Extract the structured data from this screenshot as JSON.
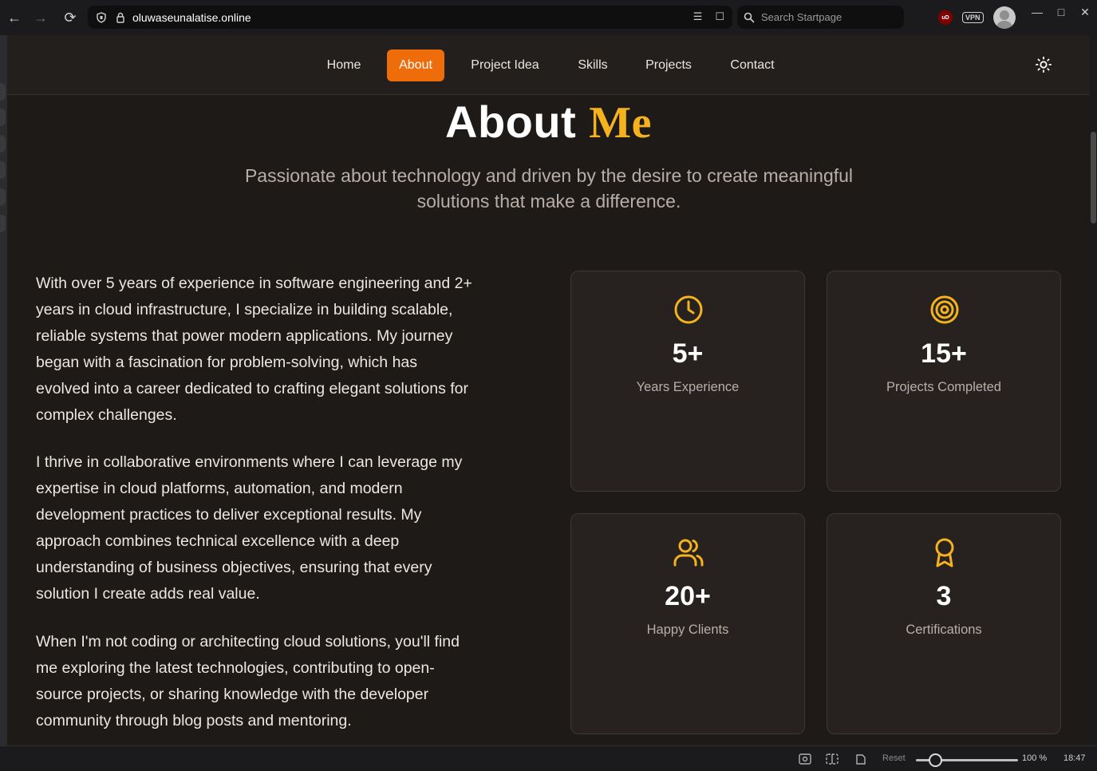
{
  "browser": {
    "url": "oluwaseunalatise.online",
    "search_placeholder": "Search Startpage",
    "ublock_label": "uD",
    "vpn_label": "VPN"
  },
  "nav": {
    "items": [
      "Home",
      "About",
      "Project Idea",
      "Skills",
      "Projects",
      "Contact"
    ],
    "active": "About"
  },
  "hero": {
    "title_main": "About",
    "title_accent": "Me",
    "subtitle_line1": "Passionate about technology and driven by the desire to create meaningful",
    "subtitle_line2": "solutions that make a difference."
  },
  "about": {
    "paragraphs": [
      [
        "With over 5 years of experience in software engineering and 2+",
        "years in cloud infrastructure, I specialize in building scalable,",
        "reliable systems that power modern applications. My journey",
        "began with a fascination for problem-solving, which has",
        "evolved into a career dedicated to crafting elegant solutions for",
        "complex challenges."
      ],
      [
        "I thrive in collaborative environments where I can leverage my",
        "expertise in cloud platforms, automation, and modern",
        "development practices to deliver exceptional results. My",
        "approach combines technical excellence with a deep",
        "understanding of business objectives, ensuring that every",
        "solution I create adds real value."
      ],
      [
        "When I'm not coding or architecting cloud solutions, you'll find",
        "me exploring the latest technologies, contributing to open-",
        "source projects, or sharing knowledge with the developer",
        "community through blog posts and mentoring."
      ]
    ]
  },
  "stats": [
    {
      "icon": "clock-icon",
      "value": "5+",
      "label": "Years Experience"
    },
    {
      "icon": "target-icon",
      "value": "15+",
      "label": "Projects Completed"
    },
    {
      "icon": "users-icon",
      "value": "20+",
      "label": "Happy Clients"
    },
    {
      "icon": "award-icon",
      "value": "3",
      "label": "Certifications"
    }
  ],
  "accent_color": "#f4b21e",
  "active_nav_color": "#ee6c0a",
  "status": {
    "reset_label": "Reset",
    "zoom": "100 %",
    "time": "18:47"
  }
}
